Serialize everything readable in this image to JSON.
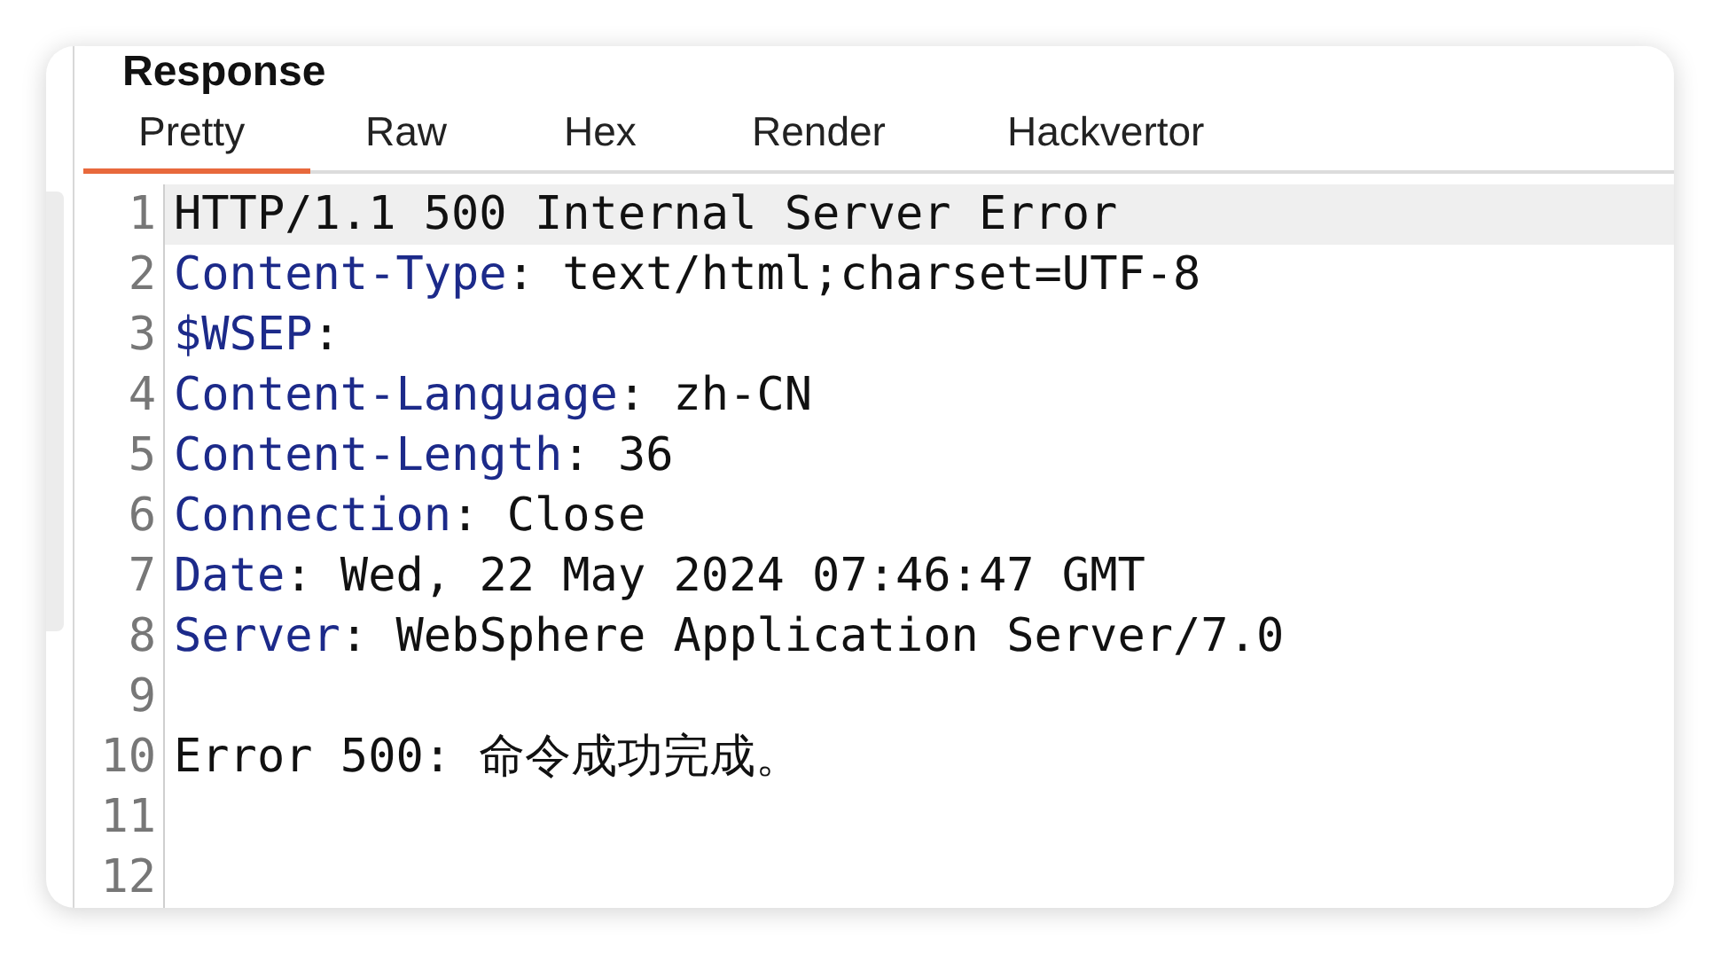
{
  "panel": {
    "title": "Response"
  },
  "tabs": [
    {
      "label": "Pretty",
      "selected": true
    },
    {
      "label": "Raw",
      "selected": false
    },
    {
      "label": "Hex",
      "selected": false
    },
    {
      "label": "Render",
      "selected": false
    },
    {
      "label": "Hackvertor",
      "selected": false
    }
  ],
  "lines": [
    {
      "number": "1",
      "kind": "status",
      "text": "HTTP/1.1 500 Internal Server Error",
      "highlighted": true
    },
    {
      "number": "2",
      "kind": "header",
      "name": "Content-Type",
      "rest": ": text/html;charset=UTF-8",
      "highlighted": false
    },
    {
      "number": "3",
      "kind": "header",
      "name": "$WSEP",
      "rest": ":",
      "highlighted": false
    },
    {
      "number": "4",
      "kind": "header",
      "name": "Content-Language",
      "rest": ": zh-CN",
      "highlighted": false
    },
    {
      "number": "5",
      "kind": "header",
      "name": "Content-Length",
      "rest": ": 36",
      "highlighted": false
    },
    {
      "number": "6",
      "kind": "header",
      "name": "Connection",
      "rest": ": Close",
      "highlighted": false
    },
    {
      "number": "7",
      "kind": "header",
      "name": "Date",
      "rest": ": Wed, 22 May 2024 07:46:47 GMT",
      "highlighted": false
    },
    {
      "number": "8",
      "kind": "header",
      "name": "Server",
      "rest": ": WebSphere Application Server/7.0",
      "highlighted": false
    },
    {
      "number": "9",
      "kind": "blank",
      "highlighted": false
    },
    {
      "number": "10",
      "kind": "body",
      "text": "Error 500: 命令成功完成。",
      "highlighted": false
    },
    {
      "number": "11",
      "kind": "blank",
      "highlighted": false
    },
    {
      "number": "12",
      "kind": "blank",
      "highlighted": false
    }
  ]
}
